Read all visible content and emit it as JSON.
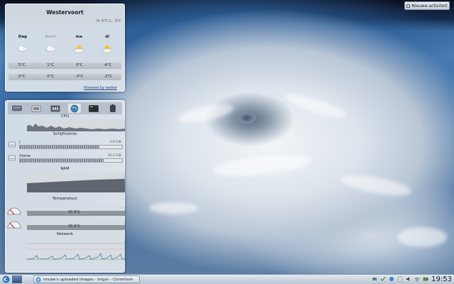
{
  "desktop": {
    "activity_button_label": "Nieuwe activiteit"
  },
  "weather": {
    "city": "Westervoort",
    "summary": "H: 5°C L: -3°C",
    "days": [
      {
        "label": "Dag",
        "icon": "cloud-icon",
        "high": "5°C",
        "low": "0°C"
      },
      {
        "label": "Nacht",
        "icon": "cloud-icon",
        "high": "1°C",
        "low": "0°C"
      },
      {
        "label": "ma",
        "icon": "sun-cloud-icon",
        "high": "3°C",
        "low": "-3°C"
      },
      {
        "label": "di",
        "icon": "sun-cloud-icon",
        "high": "4°C",
        "low": "-2°C"
      }
    ],
    "powered_by": "Powered by wetter"
  },
  "sysmon": {
    "toolbar_icons": [
      "harddisk-icon",
      "memory-icon",
      "cpu-icon",
      "network-globe-icon",
      "terminal-icon",
      "battery-icon"
    ],
    "cpu_label": "CPU",
    "disk_label": "Schijfruimte",
    "disks": [
      {
        "name": "/",
        "icon": "drive-icon",
        "free": "3.9 GiB",
        "fill": 0.78
      },
      {
        "name": "/home",
        "icon": "drive-icon",
        "free": "10.1 GiB",
        "fill": 0.82
      }
    ],
    "ram_label": "RAM",
    "temp_label": "Temperatuur",
    "temps": [
      {
        "value": "37.0°C",
        "icon": "gauge-icon"
      },
      {
        "value": "37.0°C",
        "icon": "gauge-icon"
      }
    ],
    "network_label": "Netwerk"
  },
  "taskbar": {
    "task_title": "Imube's uploaded images - Imgur - Chromium",
    "task_icon": "chromium-icon",
    "tray_icons": [
      "network-icon",
      "updates-check-icon",
      "notifications-icon",
      "clipboard-icon",
      "volume-icon",
      "wifi-icon",
      "battery-tray-icon"
    ],
    "clock": "19:53"
  },
  "colors": {
    "panel_bg": "#dee4eb",
    "accent": "#1f3f80",
    "graph_line": "#3b7fc4"
  }
}
